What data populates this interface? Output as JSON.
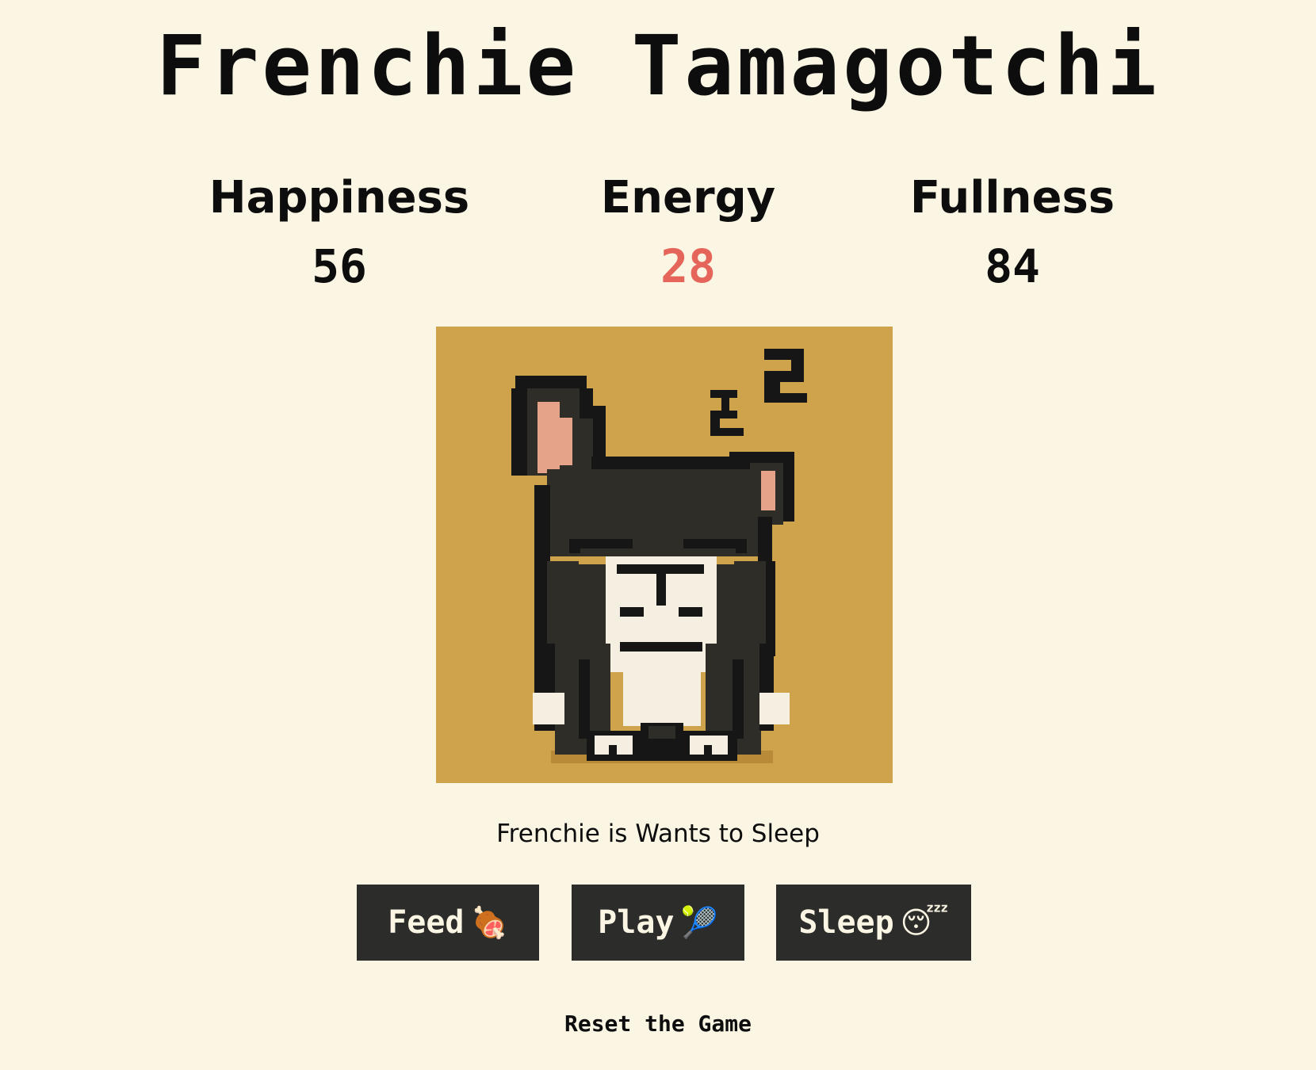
{
  "game": {
    "title": "Frenchie Tamagotchi"
  },
  "stats": [
    {
      "label": "Happiness",
      "value": "56",
      "color": "#0d0d0d"
    },
    {
      "label": "Energy",
      "value": "28",
      "color": "#e5655a"
    },
    {
      "label": "Fullness",
      "value": "84",
      "color": "#0d0d0d"
    }
  ],
  "pet": {
    "state": "sleeping",
    "background_color": "#cfa24c",
    "status_text": "Frenchie is Wants to Sleep"
  },
  "actions": {
    "feed": {
      "label": "Feed",
      "icon": "🍖",
      "icon_name": "meat-icon"
    },
    "play": {
      "label": "Play",
      "icon": "🎾",
      "icon_name": "tennis-ball-icon"
    },
    "sleep": {
      "label": "Sleep",
      "icon": "😴",
      "icon_name": "sleeping-face-icon"
    }
  },
  "reset_label": "Reset the Game",
  "colors": {
    "background": "#fbf5e4",
    "button": "#2c2c2a",
    "button_text": "#fbf5e4",
    "low_stat": "#e5655a"
  }
}
